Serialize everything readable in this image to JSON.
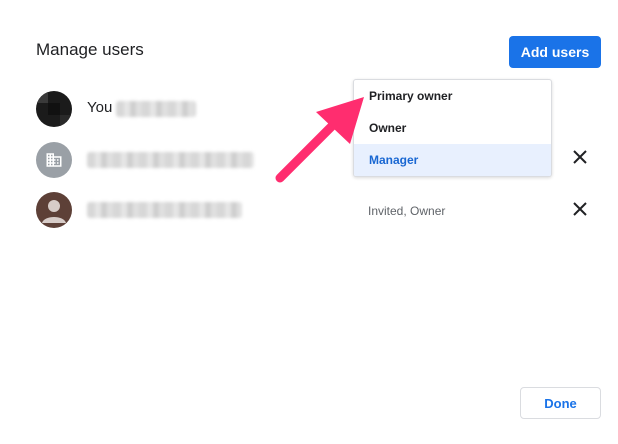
{
  "dialog": {
    "title": "Manage users",
    "add_users_label": "Add users",
    "done_label": "Done"
  },
  "users": [
    {
      "name_prefix": "You",
      "status": "",
      "avatar": "photo-avatar",
      "removable": false
    },
    {
      "name_prefix": "",
      "status": "",
      "avatar": "business-icon",
      "removable": true
    },
    {
      "name_prefix": "",
      "status": "Invited, Owner",
      "avatar": "person-icon",
      "removable": true
    }
  ],
  "role_dropdown": {
    "options": [
      "Primary owner",
      "Owner",
      "Manager"
    ],
    "selected": "Manager"
  },
  "annotation": {
    "arrow_color": "#ff2d6f"
  },
  "colors": {
    "accent": "#1a73e8",
    "selected_bg": "#e8f0fe"
  }
}
